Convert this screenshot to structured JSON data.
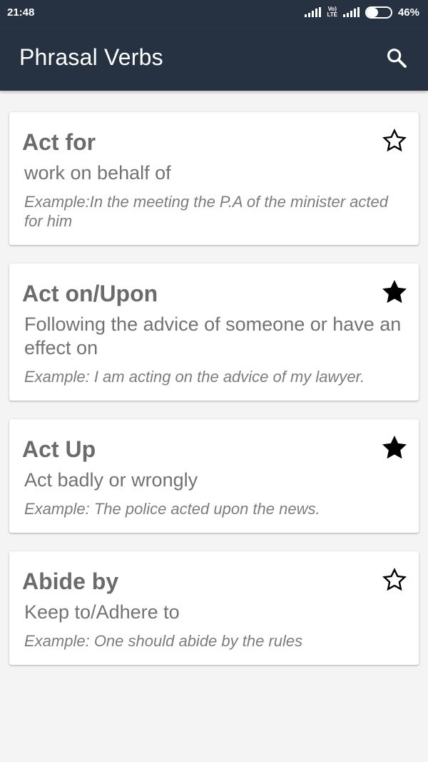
{
  "status_bar": {
    "time": "21:48",
    "network_label_top": "Vo)",
    "network_label_bottom": "LTE",
    "battery_text": "46%",
    "battery_level": 0.46
  },
  "app_bar": {
    "title": "Phrasal Verbs",
    "search_icon": "search-icon",
    "background": "#263241"
  },
  "cards": [
    {
      "title": "Act for",
      "meaning": "work on behalf of",
      "example": "Example:In the meeting the P.A of the minister acted for him",
      "favorite": false
    },
    {
      "title": "Act on/Upon",
      "meaning": "Following the advice of someone or have an effect on",
      "example": "Example: I am acting on the advice of my lawyer.",
      "favorite": true
    },
    {
      "title": "Act Up",
      "meaning": "Act badly or wrongly",
      "example": "Example: The police acted upon the news.",
      "favorite": true
    },
    {
      "title": "Abide by",
      "meaning": "Keep to/Adhere to",
      "example": "Example: One should abide by the rules",
      "favorite": false
    }
  ]
}
